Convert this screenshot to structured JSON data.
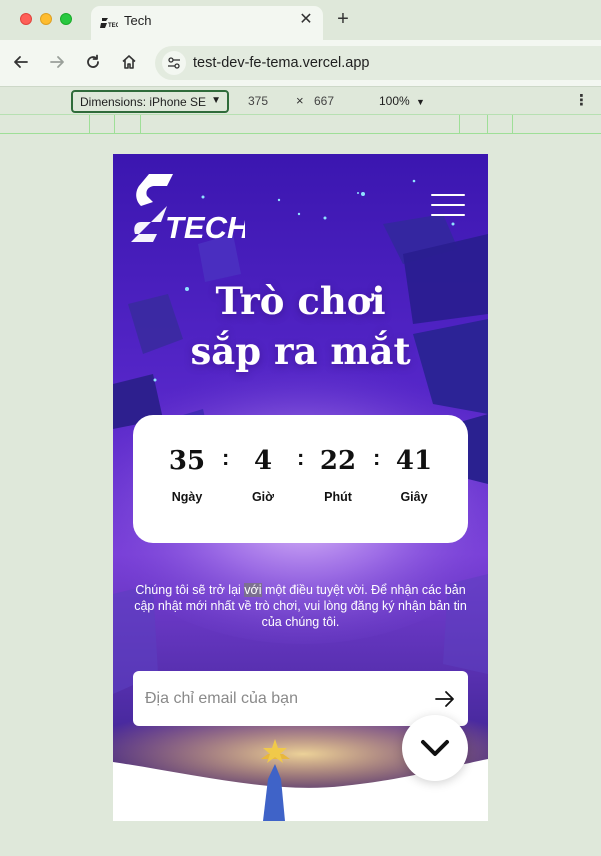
{
  "browser": {
    "tab_title": "Tech",
    "url": "test-dev-fe-tema.vercel.app",
    "devtools": {
      "dimensions_label": "Dimensions: iPhone SE",
      "width": "375",
      "separator": "×",
      "height": "667",
      "zoom": "100%"
    }
  },
  "page": {
    "logo_text": "TECH",
    "headline": [
      "Trò chơi",
      "sắp ra mắt"
    ],
    "countdown": {
      "days": {
        "value": "35",
        "label": "Ngày"
      },
      "hours": {
        "value": "4",
        "label": "Giờ"
      },
      "minutes": {
        "value": "22",
        "label": "Phút"
      },
      "seconds": {
        "value": "41",
        "label": "Giây"
      },
      "separator": ":"
    },
    "description_before": "Chúng tôi sẽ trở lại ",
    "description_highlight": "với",
    "description_after": " một điều tuyệt vời. Để nhận các bản cập nhật mới nhất về trò chơi, vui lòng đăng ký nhận bản tin của chúng tôi.",
    "email_placeholder": "Địa chỉ email của bạn"
  },
  "icons": {
    "back": "arrow-left-icon",
    "forward": "arrow-right-icon",
    "reload": "reload-icon",
    "home": "home-icon",
    "site_settings": "tune-icon",
    "menu": "hamburger-icon",
    "submit": "arrow-right-icon",
    "scroll": "chevron-down-icon"
  },
  "colors": {
    "hero_top": "#3a14a8",
    "hero_mid": "#6a2fd6",
    "accent_gold": "#f0c94a"
  }
}
